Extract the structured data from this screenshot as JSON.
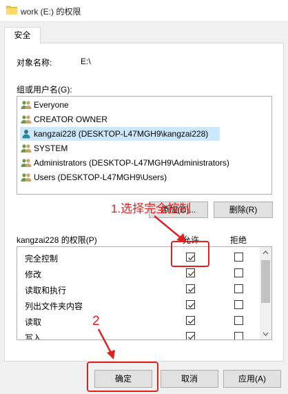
{
  "window": {
    "title": "work (E:) 的权限"
  },
  "tab": {
    "label": "安全"
  },
  "object": {
    "label": "对象名称:",
    "value": "E:\\"
  },
  "groups": {
    "label": "组或用户名(G):",
    "items": [
      {
        "name": "Everyone",
        "icon": "users-group-icon"
      },
      {
        "name": "CREATOR OWNER",
        "icon": "users-group-icon"
      },
      {
        "name": "kangzai228 (DESKTOP-L47MGH9\\kangzai228)",
        "icon": "user-icon"
      },
      {
        "name": "SYSTEM",
        "icon": "users-group-icon"
      },
      {
        "name": "Administrators (DESKTOP-L47MGH9\\Administrators)",
        "icon": "users-group-icon"
      },
      {
        "name": "Users (DESKTOP-L47MGH9\\Users)",
        "icon": "users-group-icon"
      }
    ],
    "selected_index": 2
  },
  "buttons": {
    "add": "添加(D)...",
    "remove": "删除(R)"
  },
  "permissions": {
    "label": "kangzai228 的权限(P)",
    "allow_header": "允许",
    "deny_header": "拒绝",
    "rows": [
      {
        "name": "完全控制",
        "allow": true,
        "deny": false
      },
      {
        "name": "修改",
        "allow": true,
        "deny": false
      },
      {
        "name": "读取和执行",
        "allow": true,
        "deny": false
      },
      {
        "name": "列出文件夹内容",
        "allow": true,
        "deny": false
      },
      {
        "name": "读取",
        "allow": true,
        "deny": false
      },
      {
        "name": "写入",
        "allow": true,
        "deny": false
      }
    ]
  },
  "annotations": {
    "step1": "1.选择完全控制",
    "step2": "2"
  },
  "footer": {
    "ok": "确定",
    "cancel": "取消",
    "apply": "应用(A)"
  },
  "colors": {
    "annotation": "#e02020",
    "selection": "#cce8ff",
    "checkmark": "#333333"
  }
}
